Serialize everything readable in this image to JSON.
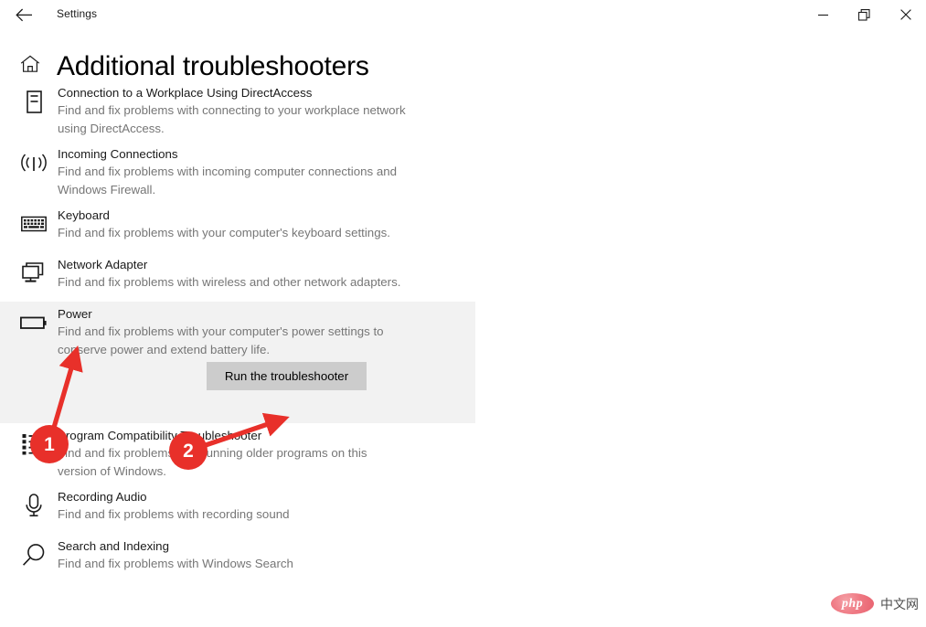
{
  "window": {
    "title": "Settings",
    "back_icon": "back-arrow-icon",
    "controls": {
      "minimize": "minimize-icon",
      "maximize": "restore-icon",
      "close": "close-icon"
    }
  },
  "header": {
    "home_icon": "home-icon",
    "title": "Additional troubleshooters"
  },
  "troubleshooters": [
    {
      "icon": "directaccess-icon",
      "name": "Connection to a Workplace Using DirectAccess",
      "desc": "Find and fix problems with connecting to your workplace network using DirectAccess.",
      "selected": false
    },
    {
      "icon": "incoming-connections-icon",
      "name": "Incoming Connections",
      "desc": "Find and fix problems with incoming computer connections and Windows Firewall.",
      "selected": false
    },
    {
      "icon": "keyboard-icon",
      "name": "Keyboard",
      "desc": "Find and fix problems with your computer's keyboard settings.",
      "selected": false
    },
    {
      "icon": "network-adapter-icon",
      "name": "Network Adapter",
      "desc": "Find and fix problems with wireless and other network adapters.",
      "selected": false
    },
    {
      "icon": "battery-icon",
      "name": "Power",
      "desc": "Find and fix problems with your computer's power settings to conserve power and extend battery life.",
      "selected": true,
      "action_label": "Run the troubleshooter"
    },
    {
      "icon": "program-list-icon",
      "name": "Program Compatibility Troubleshooter",
      "desc": "Find and fix problems with running older programs on this version of Windows.",
      "selected": false
    },
    {
      "icon": "microphone-icon",
      "name": "Recording Audio",
      "desc": "Find and fix problems with recording sound",
      "selected": false
    },
    {
      "icon": "search-icon",
      "name": "Search and Indexing",
      "desc": "Find and fix problems with Windows Search",
      "selected": false
    }
  ],
  "annotations": {
    "accent_color": "#e8302a",
    "markers": [
      {
        "label": "1",
        "target": "power-item-description"
      },
      {
        "label": "2",
        "target": "run-troubleshooter-button"
      }
    ]
  },
  "watermark": {
    "logo_text": "php",
    "site_text": "中文网"
  }
}
